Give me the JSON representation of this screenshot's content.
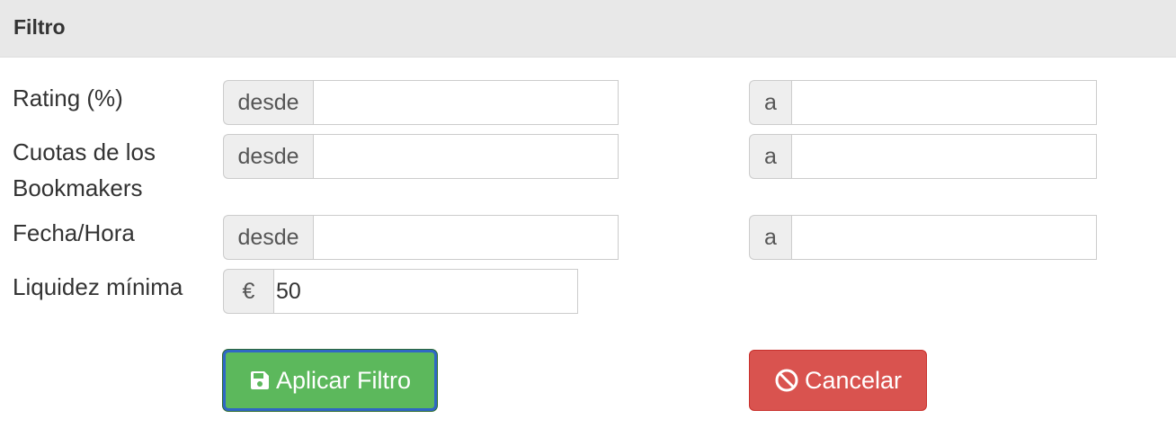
{
  "panel": {
    "title": "Filtro"
  },
  "rows": [
    {
      "label": "Rating (%)",
      "from_addon": "desde",
      "to_addon": "a",
      "from_value": "",
      "to_value": ""
    },
    {
      "label": "Cuotas de los Bookmakers",
      "from_addon": "desde",
      "to_addon": "a",
      "from_value": "",
      "to_value": ""
    },
    {
      "label": "Fecha/Hora",
      "from_addon": "desde",
      "to_addon": "a",
      "from_value": "",
      "to_value": ""
    },
    {
      "label": "Liquidez mínima",
      "currency_addon": "€",
      "value": "50"
    }
  ],
  "buttons": {
    "apply": {
      "label": "Aplicar Filtro",
      "icon": "floppy-disk-icon",
      "color": "#5cb85c"
    },
    "cancel": {
      "label": "Cancelar",
      "icon": "ban-icon",
      "color": "#d9534f"
    }
  }
}
